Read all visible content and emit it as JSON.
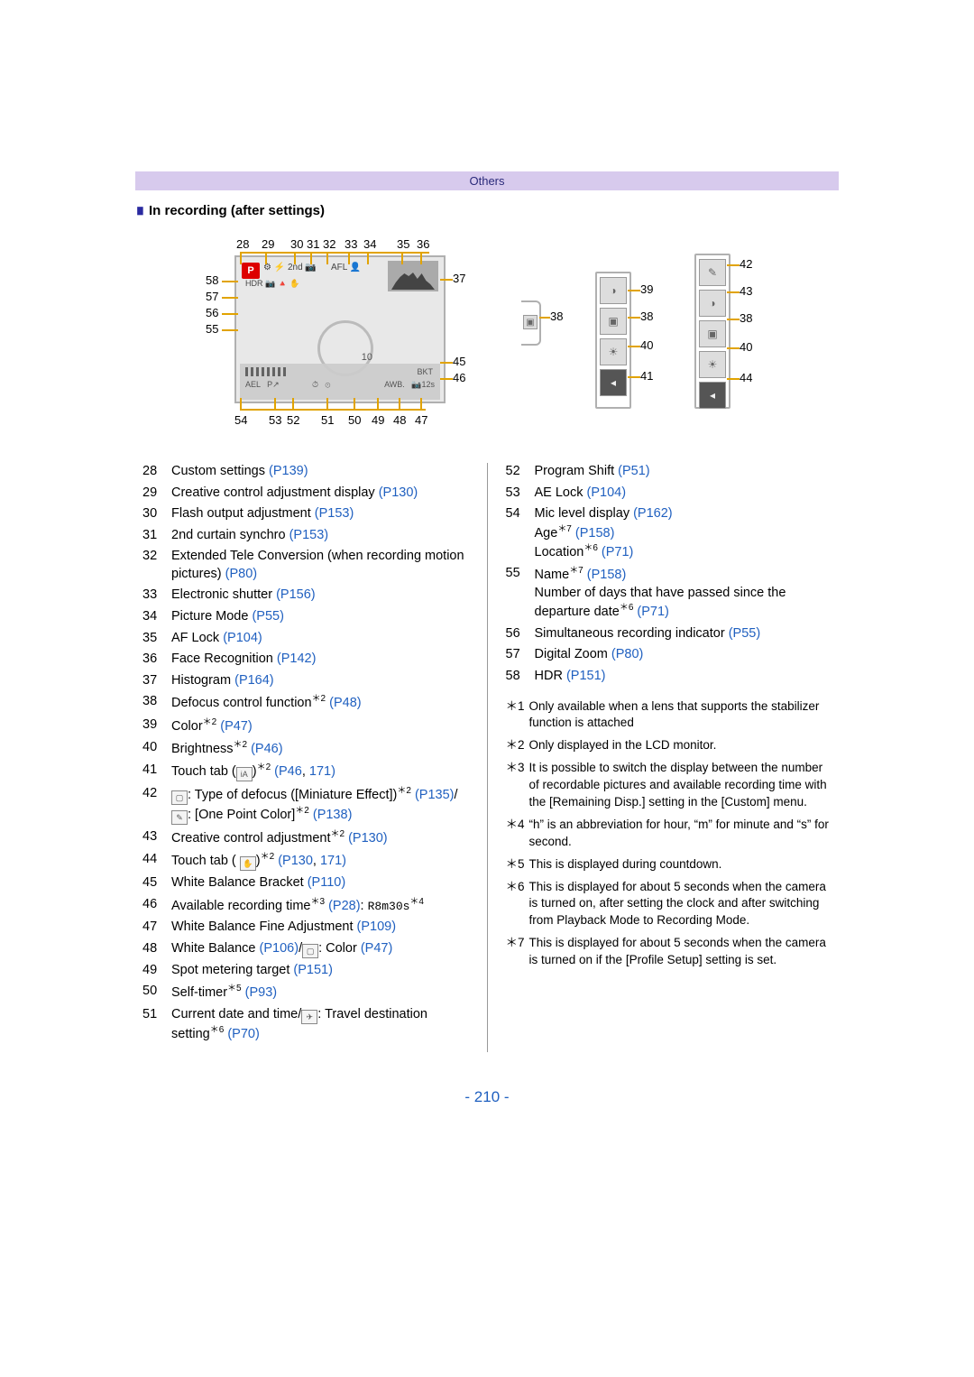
{
  "header": {
    "category": "Others"
  },
  "section": {
    "title": "In recording (after settings)"
  },
  "page_number": "- 210 -",
  "diagram_numbers_top": [
    "28",
    "29",
    "30",
    "31",
    "32",
    "33",
    "34",
    "35",
    "36"
  ],
  "diagram_numbers_left": [
    "58",
    "57",
    "56",
    "55"
  ],
  "diagram_numbers_right_a": [
    "37",
    "45",
    "46"
  ],
  "diagram_numbers_bottom": [
    "54",
    "53",
    "52",
    "51",
    "50",
    "49",
    "48",
    "47"
  ],
  "diagram_numbers_panel1": [
    "38"
  ],
  "diagram_numbers_panel2": [
    "42",
    "39",
    "43",
    "38",
    "40",
    "41"
  ],
  "diagram_numbers_panel3": [
    "38",
    "40",
    "44"
  ],
  "screen_labels": {
    "p": "P",
    "hdr": "HDR",
    "afl": "AFL",
    "awb": "AWB",
    "timer": "12s",
    "count": "10"
  },
  "legend_left": [
    {
      "n": "28",
      "text": "Custom settings ",
      "refs": [
        "(P139)"
      ]
    },
    {
      "n": "29",
      "text": "Creative control adjustment display ",
      "refs": [
        "(P130)"
      ]
    },
    {
      "n": "30",
      "text": "Flash output adjustment ",
      "refs": [
        "(P153)"
      ]
    },
    {
      "n": "31",
      "text": "2nd curtain synchro ",
      "refs": [
        "(P153)"
      ]
    },
    {
      "n": "32",
      "text": "Extended Tele Conversion (when recording motion pictures) ",
      "refs": [
        "(P80)"
      ]
    },
    {
      "n": "33",
      "text": "Electronic shutter ",
      "refs": [
        "(P156)"
      ]
    },
    {
      "n": "34",
      "text": "Picture Mode ",
      "refs": [
        "(P55)"
      ]
    },
    {
      "n": "35",
      "text": "AF Lock ",
      "refs": [
        "(P104)"
      ]
    },
    {
      "n": "36",
      "text": "Face Recognition ",
      "refs": [
        "(P142)"
      ]
    },
    {
      "n": "37",
      "text": "Histogram ",
      "refs": [
        "(P164)"
      ]
    },
    {
      "n": "38",
      "text": "Defocus control function",
      "sup": "＊2",
      "refs": [
        " (P48)"
      ]
    },
    {
      "n": "39",
      "text": "Color",
      "sup": "＊2",
      "refs": [
        " (P47)"
      ]
    },
    {
      "n": "40",
      "text": "Brightness",
      "sup": "＊2",
      "refs": [
        " (P46)"
      ]
    },
    {
      "n": "41",
      "text": "Touch tab (",
      "icon": "iA",
      "text2": ")",
      "sup": "＊2",
      "refs": [
        " (P46",
        ", ",
        "171)"
      ]
    },
    {
      "n": "42",
      "text": "",
      "icon": "▢",
      "text2": ": Type of defocus ([Miniature Effect])",
      "sup": "＊2",
      "refs": [
        " (P135)"
      ],
      "trail": "/",
      "line2_icon": "✎",
      "line2_text": ": [One Point Color]",
      "line2_sup": "＊2",
      "line2_refs": [
        " (P138)"
      ]
    },
    {
      "n": "43",
      "text": "Creative control adjustment",
      "sup": "＊2",
      "refs": [
        " (P130)"
      ]
    },
    {
      "n": "44",
      "text": "Touch tab ( ",
      "icon": "✋",
      "text2": ")",
      "sup": "＊2",
      "refs": [
        " (P130",
        ", ",
        "171)"
      ]
    },
    {
      "n": "45",
      "text": "White Balance Bracket ",
      "refs": [
        "(P110)"
      ]
    },
    {
      "n": "46",
      "text": "Available recording time",
      "sup": "＊3",
      "refs": [
        " (P28)"
      ],
      "trail": ": ",
      "sample": "R8m30s",
      "sample_sup": "＊4"
    },
    {
      "n": "47",
      "text": "White Balance Fine Adjustment ",
      "refs": [
        "(P109)"
      ]
    },
    {
      "n": "48",
      "text": "White Balance ",
      "refs": [
        "(P106)"
      ],
      "trail": "/",
      "icon2": "▢",
      "text3": ": Color ",
      "refs2": [
        "(P47)"
      ]
    },
    {
      "n": "49",
      "text": "Spot metering target ",
      "refs": [
        "(P151)"
      ]
    },
    {
      "n": "50",
      "text": "Self-timer",
      "sup": "＊5",
      "refs": [
        " (P93)"
      ]
    },
    {
      "n": "51",
      "text": "Current date and time/",
      "icon": "✈",
      "text2": ": Travel destination setting",
      "sup": "＊6",
      "refs": [
        " (P70)"
      ]
    }
  ],
  "legend_right": [
    {
      "n": "52",
      "text": "Program Shift ",
      "refs": [
        "(P51)"
      ]
    },
    {
      "n": "53",
      "text": "AE Lock ",
      "refs": [
        "(P104)"
      ]
    },
    {
      "n": "54",
      "text": "Mic level display ",
      "refs": [
        "(P162)"
      ],
      "sub": [
        {
          "text": "Age",
          "sup": "＊7",
          "refs": [
            " (P158)"
          ]
        },
        {
          "text": "Location",
          "sup": "＊6",
          "refs": [
            " (P71)"
          ]
        }
      ]
    },
    {
      "n": "55",
      "text": "Name",
      "sup": "＊7",
      "refs": [
        " (P158)"
      ],
      "sub": [
        {
          "text": "Number of days that have passed since the departure date",
          "sup": "＊6",
          "refs": [
            " (P71)"
          ]
        }
      ]
    },
    {
      "n": "56",
      "text": "Simultaneous recording indicator ",
      "refs": [
        "(P55)"
      ]
    },
    {
      "n": "57",
      "text": "Digital Zoom ",
      "refs": [
        "(P80)"
      ]
    },
    {
      "n": "58",
      "text": "HDR ",
      "refs": [
        "(P151)"
      ]
    }
  ],
  "footnotes": [
    {
      "k": "＊1",
      "t": "Only available when a lens that supports the stabilizer function is attached"
    },
    {
      "k": "＊2",
      "t": "Only displayed in the LCD monitor."
    },
    {
      "k": "＊3",
      "t": "It is possible to switch the display between the number of recordable pictures and available recording time with the [Remaining Disp.] setting in the [Custom] menu."
    },
    {
      "k": "＊4",
      "t": "“h” is an abbreviation for hour, “m” for minute and “s” for second."
    },
    {
      "k": "＊5",
      "t": "This is displayed during countdown."
    },
    {
      "k": "＊6",
      "t": "This is displayed for about 5 seconds when the camera is turned on, after setting the clock and after switching from Playback Mode to Recording Mode."
    },
    {
      "k": "＊7",
      "t": "This is displayed for about 5 seconds when the camera is turned on if the [Profile Setup] setting is set."
    }
  ]
}
